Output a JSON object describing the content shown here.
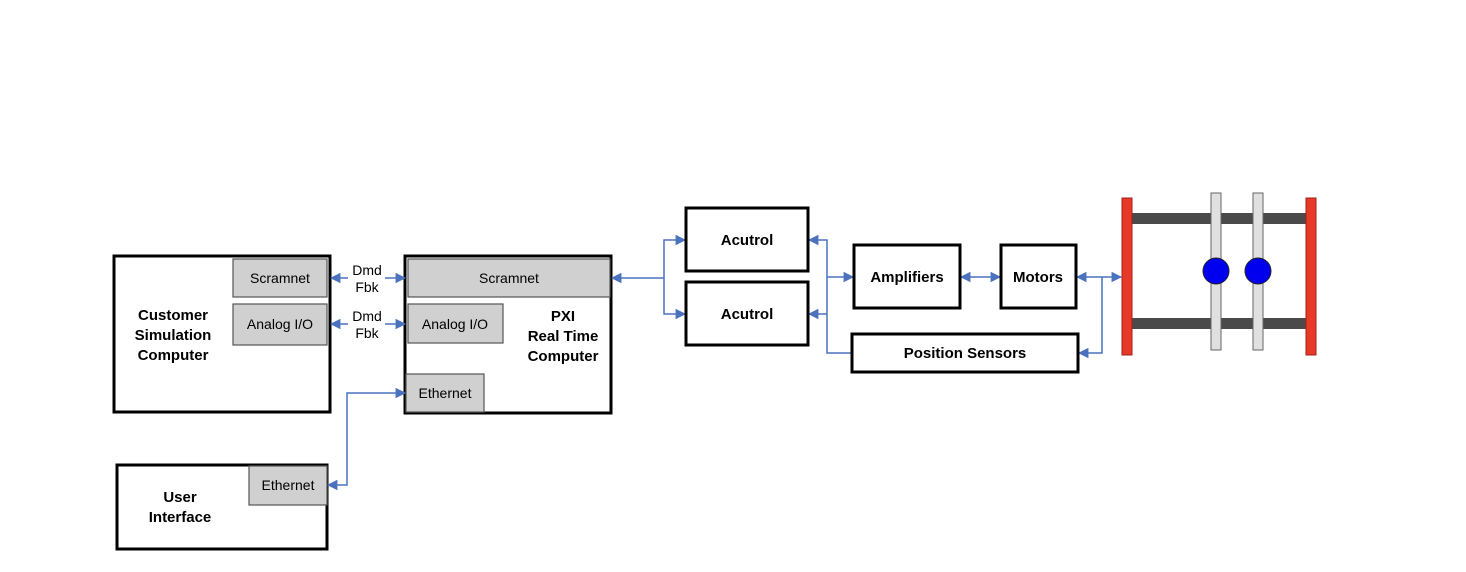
{
  "customer_computer": {
    "title_lines": [
      "Customer",
      "Simulation",
      "Computer"
    ],
    "ports": [
      "Scramnet",
      "Analog I/O"
    ]
  },
  "pxi_computer": {
    "title_lines": [
      "PXI",
      "Real Time",
      "Computer"
    ],
    "ports": [
      "Scramnet",
      "Analog I/O",
      "Ethernet"
    ]
  },
  "user_interface": {
    "title_lines": [
      "User",
      "Interface"
    ],
    "port": "Ethernet"
  },
  "link_labels": [
    {
      "top": "Dmd",
      "bottom": "Fbk"
    },
    {
      "top": "Dmd",
      "bottom": "Fbk"
    }
  ],
  "acutrols": [
    "Acutrol",
    "Acutrol"
  ],
  "amplifiers": "Amplifiers",
  "motors": "Motors",
  "position_sensors": "Position Sensors",
  "colors": {
    "arrow": "#4a72bd",
    "frame_red": "#e8382a",
    "rail_dark": "#4a4a4a",
    "shaft_gray": "#e0e0e0",
    "mass_blue": "#0000ee",
    "port_fill": "#d0d0d0"
  }
}
